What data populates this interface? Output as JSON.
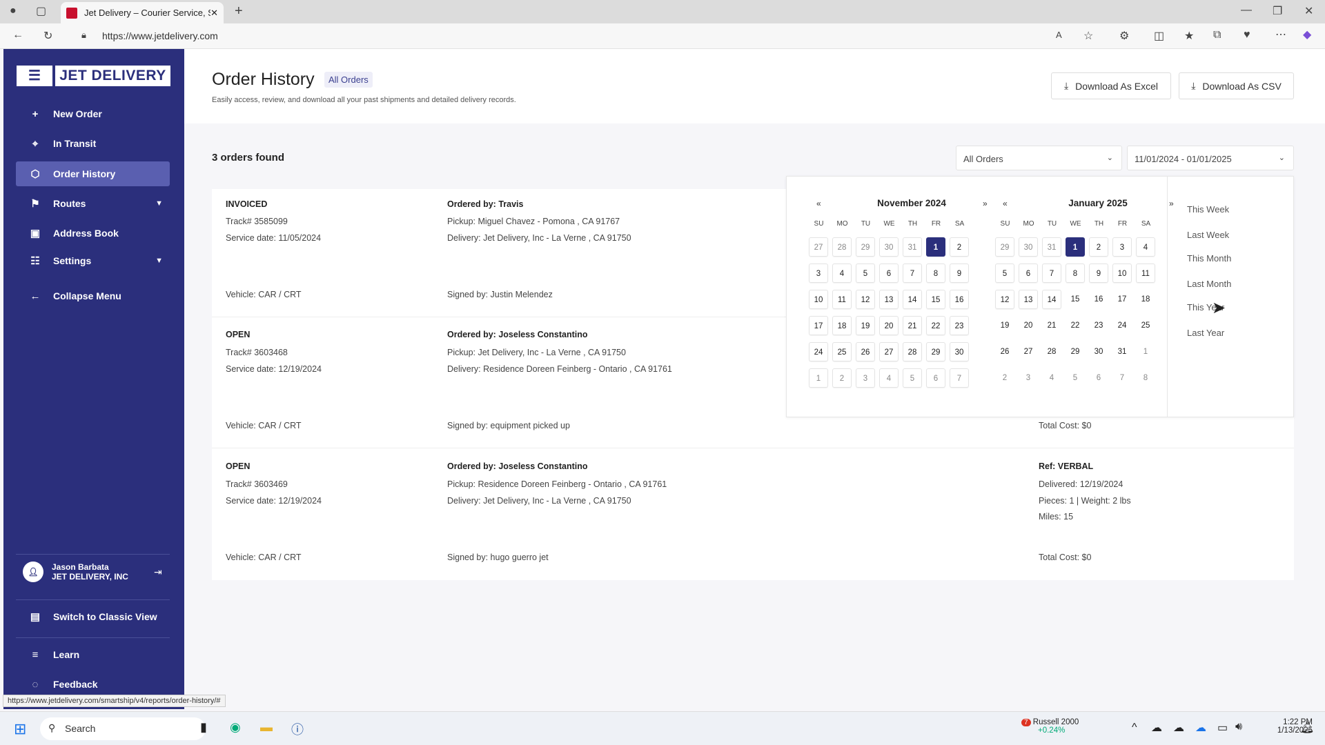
{
  "browser": {
    "tab_title": "Jet Delivery – Courier Service, San",
    "url": "https://www.jetdelivery.com",
    "status_url": "https://www.jetdelivery.com/smartship/v4/reports/order-history/#"
  },
  "sidebar": {
    "logo": "JET DELIVERY",
    "items": [
      {
        "label": "New Order",
        "icon": "plus-icon"
      },
      {
        "label": "In Transit",
        "icon": "location-pin-icon"
      },
      {
        "label": "Order History",
        "icon": "box-icon",
        "active": true
      },
      {
        "label": "Routes",
        "icon": "route-icon"
      },
      {
        "label": "Address Book",
        "icon": "address-book-icon"
      },
      {
        "label": "Settings",
        "icon": "sliders-icon"
      },
      {
        "label": "Collapse Menu",
        "icon": "arrow-left-icon"
      }
    ],
    "user": {
      "name": "Jason Barbata",
      "company": "JET DELIVERY, INC"
    },
    "bottom": [
      {
        "label": "Switch to Classic View"
      },
      {
        "label": "Learn"
      },
      {
        "label": "Feedback"
      }
    ]
  },
  "header": {
    "title": "Order History",
    "badge": "All Orders",
    "subtitle": "Easily access, review, and download all your past shipments and detailed delivery records.",
    "excel": "Download As Excel",
    "csv": "Download As CSV"
  },
  "filters": {
    "count": "3 orders found",
    "status": "All Orders",
    "range": "11/01/2024 - 01/01/2025"
  },
  "orders": [
    {
      "status": "INVOICED",
      "track": "Track# 3585099",
      "service": "Service date: 11/05/2024",
      "ordered": "Ordered by: Travis",
      "pickup": "Pickup: Miguel Chavez - Pomona , CA 91767",
      "delivery": "Delivery: Jet Delivery, Inc - La Verne , CA 91750",
      "vehicle": "Vehicle: CAR / CRT",
      "signed": "Signed by: Justin Melendez"
    },
    {
      "status": "OPEN",
      "track": "Track# 3603468",
      "service": "Service date: 12/19/2024",
      "ordered": "Ordered by: Joseless Constantino",
      "pickup": "Pickup: Jet Delivery, Inc - La Verne , CA 91750",
      "delivery": "Delivery: Residence Doreen Feinberg - Ontario , CA 91761",
      "vehicle": "Vehicle: CAR / CRT",
      "signed": "Signed by: equipment picked up",
      "total": "Total Cost: $0"
    },
    {
      "status": "OPEN",
      "track": "Track# 3603469",
      "service": "Service date: 12/19/2024",
      "ordered": "Ordered by: Joseless Constantino",
      "pickup": "Pickup: Residence Doreen Feinberg - Ontario , CA 91761",
      "delivery": "Delivery: Jet Delivery, Inc - La Verne , CA 91750",
      "vehicle": "Vehicle: CAR / CRT",
      "signed": "Signed by: hugo guerro jet",
      "ref": "Ref: VERBAL",
      "delivered": "Delivered: 12/19/2024",
      "pieces": "Pieces: 1 | Weight: 2 lbs",
      "miles": "Miles: 15",
      "total": "Total Cost: $0"
    }
  ],
  "calendar": {
    "prev": "«",
    "next": "»",
    "weekdays": [
      "SU",
      "MO",
      "TU",
      "WE",
      "TH",
      "FR",
      "SA"
    ],
    "months": [
      {
        "title": "November 2024",
        "days": [
          "27",
          "28",
          "29",
          "30",
          "31",
          "1",
          "2",
          "3",
          "4",
          "5",
          "6",
          "7",
          "8",
          "9",
          "10",
          "11",
          "12",
          "13",
          "14",
          "15",
          "16",
          "17",
          "18",
          "19",
          "20",
          "21",
          "22",
          "23",
          "24",
          "25",
          "26",
          "27",
          "28",
          "29",
          "30",
          "1",
          "2",
          "3",
          "4",
          "5",
          "6",
          "7"
        ],
        "first_in": 5,
        "last_in": 34,
        "selected": 5,
        "bordered_to": 41
      },
      {
        "title": "January 2025",
        "days": [
          "29",
          "30",
          "31",
          "1",
          "2",
          "3",
          "4",
          "5",
          "6",
          "7",
          "8",
          "9",
          "10",
          "11",
          "12",
          "13",
          "14",
          "15",
          "16",
          "17",
          "18",
          "19",
          "20",
          "21",
          "22",
          "23",
          "24",
          "25",
          "26",
          "27",
          "28",
          "29",
          "30",
          "31",
          "1",
          "2",
          "3",
          "4",
          "5",
          "6",
          "7",
          "8"
        ],
        "first_in": 3,
        "last_in": 33,
        "selected": 3,
        "bordered_to": 16
      }
    ],
    "presets": [
      "This Week",
      "Last Week",
      "This Month",
      "Last Month",
      "This Year",
      "Last Year"
    ]
  },
  "taskbar": {
    "search": "Search",
    "stock_name": "Russell 2000",
    "stock_change": "+0.24%",
    "stock_badge": "7",
    "time": "1:22 PM",
    "date": "1/13/2025"
  },
  "colors": {
    "brand": "#2b2f7c",
    "active_nav": "#5a5fb0"
  }
}
